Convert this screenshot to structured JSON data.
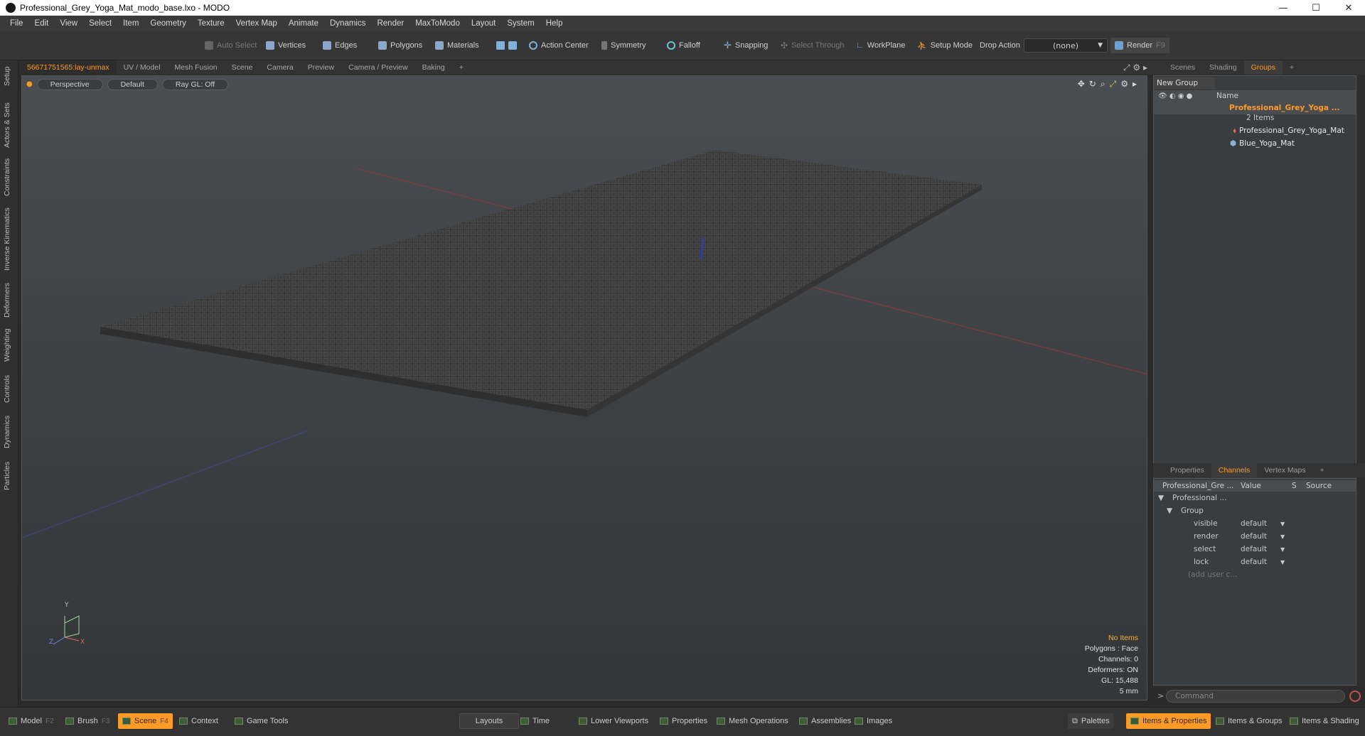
{
  "window": {
    "title": "Professional_Grey_Yoga_Mat_modo_base.lxo - MODO",
    "min": "—",
    "max": "☐",
    "close": "✕"
  },
  "menu": [
    "File",
    "Edit",
    "View",
    "Select",
    "Item",
    "Geometry",
    "Texture",
    "Vertex Map",
    "Animate",
    "Dynamics",
    "Render",
    "MaxToModo",
    "Layout",
    "System",
    "Help"
  ],
  "toolbar": {
    "auto_select": "Auto Select",
    "vertices": "Vertices",
    "edges": "Edges",
    "polygons": "Polygons",
    "materials": "Materials",
    "action_center": "Action Center",
    "symmetry": "Symmetry",
    "falloff": "Falloff",
    "snapping": "Snapping",
    "select_through": "Select Through",
    "workplane": "WorkPlane",
    "setup_mode": "Setup Mode",
    "drop_action": "Drop Action",
    "drop_value": "(none)",
    "render": "Render",
    "render_key": "F9"
  },
  "left_tabs": [
    "Setup",
    "Actors & Sets",
    "Constraints",
    "Inverse Kinematics",
    "Deformers",
    "Weighting",
    "Controls",
    "Dynamics",
    "Particles"
  ],
  "viewport_tabs": [
    "56671751565:lay-unmax",
    "UV / Model",
    "Mesh Fusion",
    "Scene",
    "Camera",
    "Preview",
    "Camera / Preview",
    "Baking",
    "+"
  ],
  "viewport": {
    "view": "Perspective",
    "shading": "Default",
    "raygl": "Ray GL: Off",
    "info": {
      "items": "No Items",
      "polygons": "Polygons : Face",
      "channels": "Channels: 0",
      "deformers": "Deformers: ON",
      "gl": "GL: 15,488",
      "scale": "5 mm"
    },
    "axis": {
      "y": "Y",
      "z": "Z",
      "x": "X"
    }
  },
  "scene_panel": {
    "tabs": [
      "Scenes",
      "Shading",
      "Groups",
      "+"
    ],
    "new_group": "New Group",
    "col_name": "Name",
    "group_name": "Professional_Grey_Yoga ...",
    "group_count": "2 Items",
    "children": [
      "Professional_Grey_Yoga_Mat",
      "Blue_Yoga_Mat"
    ]
  },
  "channels_panel": {
    "tabs": [
      "Properties",
      "Channels",
      "Vertex Maps",
      "+"
    ],
    "col_item": "Professional_Gre ...",
    "col_value": "Value",
    "col_s": "S",
    "col_source": "Source",
    "root": "Professional ...",
    "group": "Group",
    "rows": [
      {
        "name": "visible",
        "value": "default"
      },
      {
        "name": "render",
        "value": "default"
      },
      {
        "name": "select",
        "value": "default"
      },
      {
        "name": "lock",
        "value": "default"
      }
    ],
    "add_user": "(add user c..."
  },
  "command": {
    "prompt": ">",
    "placeholder": "Command"
  },
  "bottom": {
    "model": "Model",
    "model_key": "F2",
    "brush": "Brush",
    "brush_key": "F3",
    "scene": "Scene",
    "scene_key": "F4",
    "context": "Context",
    "game_tools": "Game Tools",
    "layouts": "Layouts",
    "time": "Time",
    "lower_viewports": "Lower Viewports",
    "properties": "Properties",
    "mesh_operations": "Mesh Operations",
    "assemblies": "Assemblies",
    "images": "Images",
    "palettes": "Palettes",
    "items_properties": "Items & Properties",
    "items_groups": "Items & Groups",
    "items_shading": "Items & Shading"
  },
  "colors": {
    "accent": "#ff9a26",
    "viewport": "#3e4245",
    "panel": "#3a3d40"
  }
}
